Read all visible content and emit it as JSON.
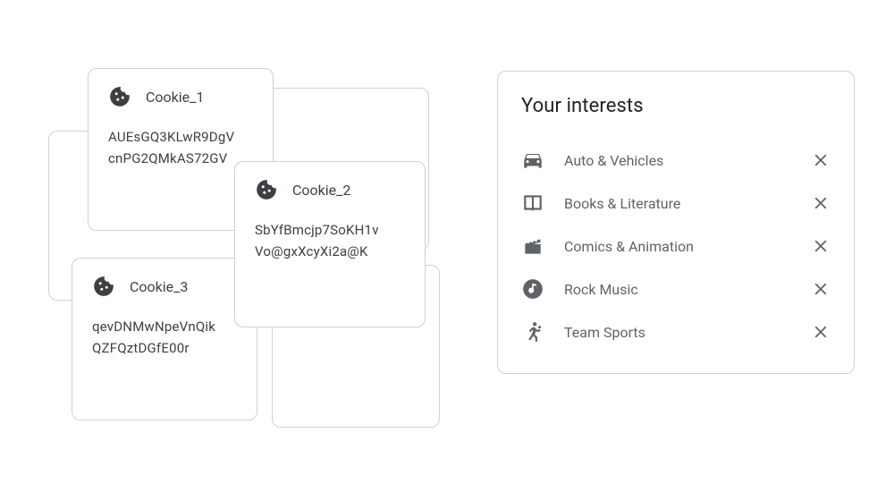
{
  "cookies": [
    {
      "name": "Cookie_1",
      "line1": "AUEsGQ3KLwR9DgV",
      "line2": "cnPG2QMkAS72GV"
    },
    {
      "name": "Cookie_2",
      "line1": "SbYfBmcjp7SoKH1v",
      "line2": "Vo@gxXcyXi2a@K"
    },
    {
      "name": "Cookie_3",
      "line1": "qevDNMwNpeVnQik",
      "line2": "QZFQztDGfE00r"
    }
  ],
  "interests": {
    "title": "Your interests",
    "items": [
      {
        "icon": "car-icon",
        "label": "Auto & Vehicles"
      },
      {
        "icon": "book-icon",
        "label": "Books & Literature"
      },
      {
        "icon": "clapper-icon",
        "label": "Comics & Animation"
      },
      {
        "icon": "music-icon",
        "label": "Rock Music"
      },
      {
        "icon": "sports-icon",
        "label": "Team Sports"
      }
    ]
  }
}
